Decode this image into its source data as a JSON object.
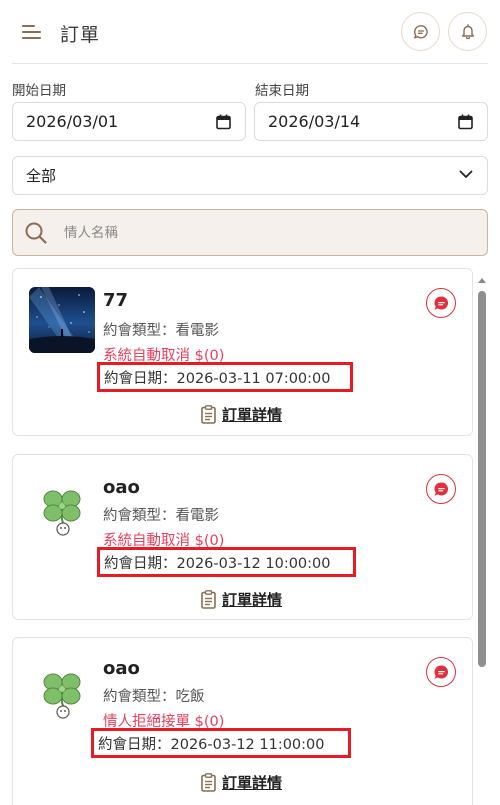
{
  "header": {
    "title": "訂單",
    "menu_icon": "menu-icon",
    "chat_icon": "chat-bubble-icon",
    "bell_icon": "bell-icon"
  },
  "filters": {
    "start_label": "開始日期",
    "start_value": "2026/03/01",
    "end_label": "結束日期",
    "end_value": "2026/03/14",
    "type_selected": "全部"
  },
  "search": {
    "placeholder": "情人名稱"
  },
  "orders": [
    {
      "name": "77",
      "type_text": "約會類型：看電影",
      "status_text": "系統自動取消 $(0)",
      "date_text": "約會日期：2026-03-11 07:00:00",
      "detail_label": "訂單詳情",
      "avatar": "night-sky-photo"
    },
    {
      "name": "oao",
      "type_text": "約會類型：看電影",
      "status_text": "系統自動取消 $(0)",
      "date_text": "約會日期：2026-03-12 10:00:00",
      "detail_label": "訂單詳情",
      "avatar": "clover-avatar"
    },
    {
      "name": "oao",
      "type_text": "約會類型：吃飯",
      "status_text": "情人拒絕接單 $(0)",
      "date_text": "約會日期：2026-03-12 11:00:00",
      "detail_label": "訂單詳情",
      "avatar": "clover-avatar"
    }
  ],
  "colors": {
    "accent": "#8a6d52",
    "status": "#e8405d",
    "highlight": "#e61b23"
  }
}
